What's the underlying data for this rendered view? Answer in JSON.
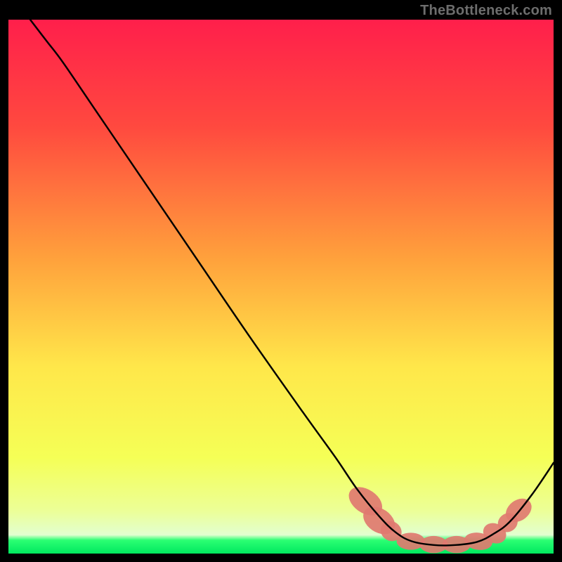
{
  "attribution": "TheBottleneck.com",
  "chart_data": {
    "type": "line",
    "title": "",
    "xlabel": "",
    "ylabel": "",
    "xlim": [
      0,
      100
    ],
    "ylim": [
      0,
      100
    ],
    "gradient_stops": [
      {
        "offset": 0,
        "color": "#ff1f4b"
      },
      {
        "offset": 20,
        "color": "#ff493f"
      },
      {
        "offset": 45,
        "color": "#ffa23c"
      },
      {
        "offset": 65,
        "color": "#ffe74a"
      },
      {
        "offset": 82,
        "color": "#f5ff56"
      },
      {
        "offset": 92,
        "color": "#ecff97"
      },
      {
        "offset": 96.5,
        "color": "#e2ffd0"
      },
      {
        "offset": 97.5,
        "color": "#2bff73"
      },
      {
        "offset": 100,
        "color": "#00e85f"
      }
    ],
    "series": [
      {
        "name": "bottleneck-curve",
        "color": "#000000",
        "points": [
          {
            "x": 4,
            "y": 100
          },
          {
            "x": 7,
            "y": 96
          },
          {
            "x": 10,
            "y": 92
          },
          {
            "x": 16,
            "y": 83
          },
          {
            "x": 24,
            "y": 71
          },
          {
            "x": 34,
            "y": 56
          },
          {
            "x": 44,
            "y": 41
          },
          {
            "x": 54,
            "y": 26.5
          },
          {
            "x": 60,
            "y": 18
          },
          {
            "x": 64,
            "y": 12
          },
          {
            "x": 68,
            "y": 7
          },
          {
            "x": 71,
            "y": 4
          },
          {
            "x": 74,
            "y": 2.3
          },
          {
            "x": 78,
            "y": 1.6
          },
          {
            "x": 82,
            "y": 1.6
          },
          {
            "x": 86,
            "y": 2.2
          },
          {
            "x": 89,
            "y": 3.7
          },
          {
            "x": 92,
            "y": 6
          },
          {
            "x": 96,
            "y": 11
          },
          {
            "x": 100,
            "y": 17
          }
        ]
      }
    ],
    "markers": [
      {
        "x": 65.5,
        "y": 9.8,
        "rx": 2.2,
        "ry": 3.4,
        "angle": -55
      },
      {
        "x": 68.0,
        "y": 6.2,
        "rx": 2.2,
        "ry": 3.2,
        "angle": -55
      },
      {
        "x": 70.2,
        "y": 4.2,
        "rx": 1.8,
        "ry": 2.0,
        "angle": -50
      },
      {
        "x": 73.8,
        "y": 2.3,
        "rx": 2.6,
        "ry": 1.6,
        "angle": 0
      },
      {
        "x": 78.0,
        "y": 1.7,
        "rx": 2.6,
        "ry": 1.6,
        "angle": 0
      },
      {
        "x": 82.2,
        "y": 1.7,
        "rx": 2.6,
        "ry": 1.6,
        "angle": 0
      },
      {
        "x": 86.2,
        "y": 2.3,
        "rx": 2.6,
        "ry": 1.6,
        "angle": 8
      },
      {
        "x": 89.2,
        "y": 3.8,
        "rx": 2.2,
        "ry": 1.8,
        "angle": 30
      },
      {
        "x": 91.6,
        "y": 5.8,
        "rx": 1.7,
        "ry": 1.9,
        "angle": 48
      },
      {
        "x": 93.6,
        "y": 8.1,
        "rx": 1.9,
        "ry": 2.6,
        "angle": 52
      }
    ],
    "marker_color": "#e07a70"
  }
}
